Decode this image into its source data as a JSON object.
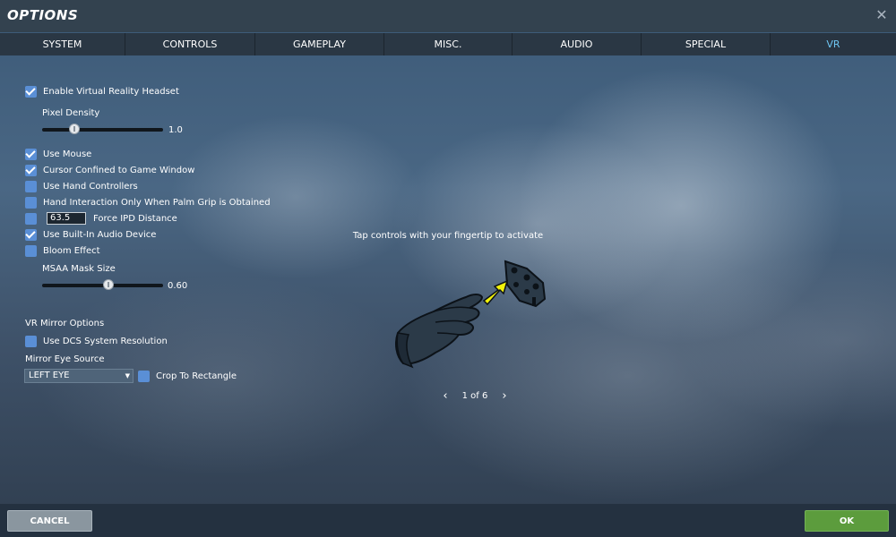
{
  "window": {
    "title": "OPTIONS",
    "close_icon": "close-icon"
  },
  "tabs": [
    {
      "label": "SYSTEM",
      "active": false
    },
    {
      "label": "CONTROLS",
      "active": false
    },
    {
      "label": "GAMEPLAY",
      "active": false
    },
    {
      "label": "MISC.",
      "active": false
    },
    {
      "label": "AUDIO",
      "active": false
    },
    {
      "label": "SPECIAL",
      "active": false
    },
    {
      "label": "VR",
      "active": true
    }
  ],
  "vr": {
    "enable_vr": {
      "label": "Enable Virtual Reality Headset",
      "checked": true
    },
    "pixel_density": {
      "label": "Pixel Density",
      "value": "1.0",
      "level": 0.4
    },
    "use_mouse": {
      "label": "Use Mouse",
      "checked": true
    },
    "cursor_confined": {
      "label": "Cursor Confined to Game Window",
      "checked": true
    },
    "hand_controllers": {
      "label": "Use Hand Controllers",
      "checked": false
    },
    "palm_grip": {
      "label": "Hand Interaction Only When Palm Grip is Obtained",
      "checked": false
    },
    "force_ipd": {
      "label": "Force IPD Distance",
      "checked": false,
      "value": "63.5"
    },
    "builtin_audio": {
      "label": "Use Built-In Audio Device",
      "checked": true
    },
    "bloom": {
      "label": "Bloom Effect",
      "checked": false
    },
    "msaa_mask": {
      "label": "MSAA Mask Size",
      "value": "0.60",
      "level": 0.6
    }
  },
  "mirror": {
    "heading": "VR Mirror Options",
    "use_dcs_resolution": {
      "label": "Use DCS System Resolution",
      "checked": false
    },
    "eye_source_label": "Mirror Eye Source",
    "eye_source_value": "LEFT EYE",
    "crop_to_rectangle": {
      "label": "Crop To Rectangle",
      "checked": false
    }
  },
  "tutorial": {
    "hint": "Tap controls with your fingertip to activate",
    "pager": "1 of 6",
    "prev_icon": "chevron-left-icon",
    "next_icon": "chevron-right-icon",
    "illustration": "glove-hand-pressing-panel-icon"
  },
  "footer": {
    "cancel_label": "CANCEL",
    "ok_label": "OK"
  },
  "colors": {
    "active_tab": "#6ec6f2",
    "checkbox": "#5a8fd6",
    "ok_button": "#5c9c3d",
    "cancel_button": "#8a969f",
    "arrow": "#f2f20a"
  }
}
